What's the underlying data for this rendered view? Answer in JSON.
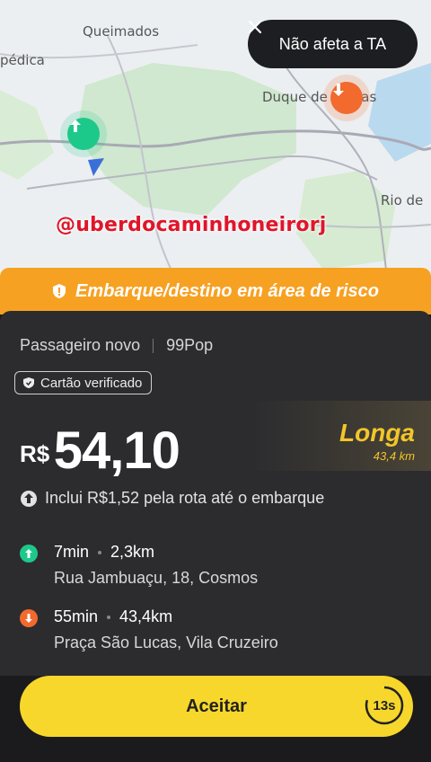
{
  "map": {
    "labels": {
      "queimados": "Queimados",
      "pedica": "pédica",
      "duque": "Duque de Caxias",
      "rio": "Rio de"
    },
    "watermark": "@uberdocaminhoneirorj"
  },
  "dismiss": {
    "label": "Não afeta a TA",
    "icon": "close-icon"
  },
  "risk_banner": {
    "text": "Embarque/destino em área de risco",
    "icon": "shield-icon"
  },
  "ride": {
    "passenger": "Passageiro novo",
    "category": "99Pop",
    "badge": "Cartão verificado",
    "currency": "R$",
    "price": "54,10",
    "distance_tag": "Longa",
    "distance_total": "43,4 km",
    "includes": "Inclui R$1,52 pela rota até o embarque"
  },
  "pickup": {
    "time": "7min",
    "distance": "2,3km",
    "address": "Rua Jambuaçu, 18, Cosmos"
  },
  "dropoff": {
    "time": "55min",
    "distance": "43,4km",
    "address": "Praça São Lucas, Vila Cruzeiro"
  },
  "actions": {
    "accept": "Aceitar",
    "timer": "13s"
  },
  "colors": {
    "accent_yellow": "#f7d72b",
    "risk_orange": "#f7a123",
    "pickup_green": "#1dc98a",
    "dropoff_orange": "#f26a2e"
  }
}
